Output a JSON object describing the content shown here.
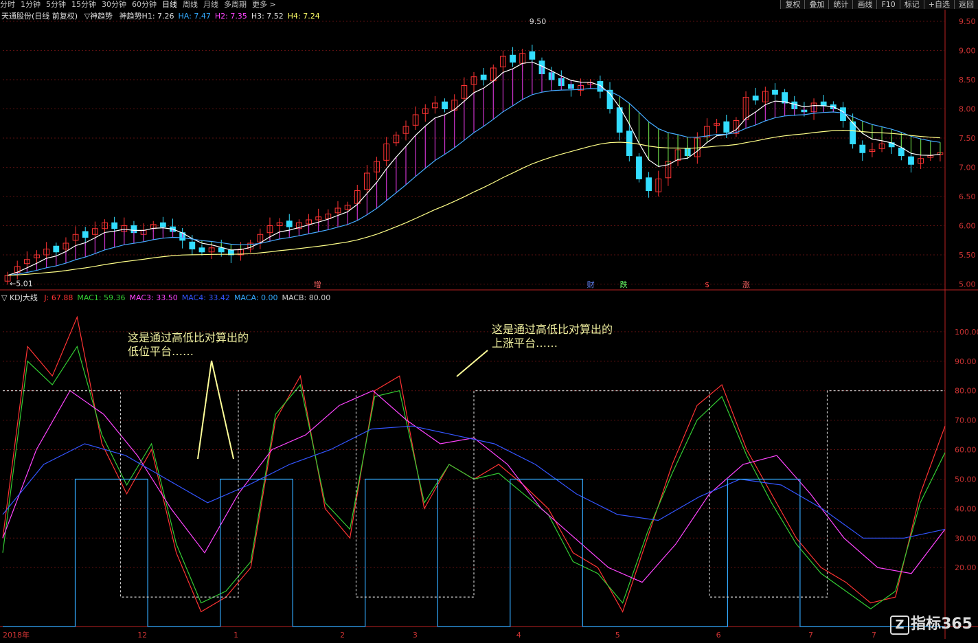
{
  "menu": {
    "periods": [
      "分时",
      "1分钟",
      "5分钟",
      "15分钟",
      "30分钟",
      "60分钟",
      "日线",
      "周线",
      "月线",
      "多周期",
      "更多 >"
    ],
    "active": "日线",
    "right_buttons": [
      "复权",
      "叠加",
      "统计",
      "画线",
      "F10",
      "标记",
      "+自选",
      "返回"
    ]
  },
  "main_info": {
    "title": "天通股份(日线 前复权)",
    "indicator": "▽神趋势",
    "items": [
      {
        "label": "神趋势H1: 7.26",
        "color": "#dddddd"
      },
      {
        "label": "HA: 7.47",
        "color": "#33aaff"
      },
      {
        "label": "H2: 7.35",
        "color": "#ff44ff"
      },
      {
        "label": "H3: 7.52",
        "color": "#dddddd"
      },
      {
        "label": "H4: 7.24",
        "color": "#ffff66"
      }
    ]
  },
  "sub_info": {
    "indicator": "▽ KDJ大线",
    "items": [
      {
        "label": "J: 67.88",
        "color": "#ff3333"
      },
      {
        "label": "MAC1: 59.36",
        "color": "#33cc33"
      },
      {
        "label": "MAC3: 33.50",
        "color": "#ff44ff"
      },
      {
        "label": "MAC4: 33.42",
        "color": "#3355ff"
      },
      {
        "label": "MACA: 0.00",
        "color": "#33aaff"
      },
      {
        "label": "MACB: 80.00",
        "color": "#cccccc"
      }
    ]
  },
  "price_axis": [
    "9.50",
    "9.00",
    "8.50",
    "8.00",
    "7.50",
    "7.00",
    "6.50",
    "6.00",
    "5.50",
    "5.00"
  ],
  "kdj_axis": [
    "100.00",
    "90.00",
    "80.00",
    "70.00",
    "60.00",
    "50.00",
    "40.00",
    "30.00",
    "20.00"
  ],
  "x_labels": [
    "2018年",
    "12",
    "1",
    "2",
    "3",
    "4",
    "5",
    "6",
    "7",
    "7"
  ],
  "marks": {
    "high": "9.50",
    "low": "5.01"
  },
  "events": [
    {
      "text": "增",
      "color": "#ff6666"
    },
    {
      "text": "财",
      "color": "#6688ff"
    },
    {
      "text": "跌",
      "color": "#66ff66"
    },
    {
      "text": "$",
      "color": "#ff4444"
    },
    {
      "text": "涨",
      "color": "#ff6666"
    }
  ],
  "annotations": [
    {
      "line1": "这是通过高低比对算出的",
      "line2": "低位平台……"
    },
    {
      "line1": "这是通过高低比对算出的",
      "line2": "上涨平台……"
    }
  ],
  "watermark": "指标365",
  "chart_data": [
    {
      "type": "candlestick",
      "ylim": [
        4.9,
        9.7
      ],
      "close": [
        5.15,
        5.3,
        5.42,
        5.5,
        5.6,
        5.55,
        5.7,
        5.85,
        5.8,
        5.95,
        6.05,
        5.95,
        6.0,
        5.88,
        5.92,
        6.02,
        5.98,
        5.9,
        5.75,
        5.6,
        5.55,
        5.62,
        5.55,
        5.5,
        5.6,
        5.7,
        5.85,
        6.0,
        6.05,
        5.98,
        6.05,
        6.1,
        6.15,
        6.2,
        6.3,
        6.35,
        6.6,
        6.9,
        7.1,
        7.4,
        7.55,
        7.7,
        7.9,
        8.0,
        8.1,
        8.0,
        8.15,
        8.4,
        8.55,
        8.5,
        8.7,
        8.9,
        8.8,
        8.95,
        8.85,
        8.6,
        8.5,
        8.4,
        8.35,
        8.4,
        8.45,
        8.3,
        8.0,
        7.6,
        7.2,
        6.8,
        6.6,
        6.8,
        7.1,
        7.3,
        7.2,
        7.5,
        7.7,
        7.75,
        7.6,
        7.8,
        8.2,
        8.15,
        8.3,
        8.25,
        8.1,
        8.0,
        7.95,
        8.1,
        8.05,
        8.0,
        7.8,
        7.4,
        7.25,
        7.3,
        7.4,
        7.35,
        7.2,
        7.05,
        7.15,
        7.2,
        7.25
      ],
      "open": [
        5.05,
        5.2,
        5.35,
        5.45,
        5.5,
        5.65,
        5.6,
        5.75,
        5.9,
        5.85,
        5.95,
        6.05,
        5.9,
        6.0,
        5.85,
        5.95,
        6.05,
        5.98,
        5.88,
        5.72,
        5.62,
        5.55,
        5.62,
        5.58,
        5.5,
        5.6,
        5.72,
        5.88,
        6.0,
        6.08,
        5.95,
        6.03,
        6.1,
        6.12,
        6.22,
        6.28,
        6.38,
        6.62,
        6.92,
        7.12,
        7.42,
        7.58,
        7.72,
        7.92,
        8.02,
        8.12,
        7.98,
        8.18,
        8.42,
        8.58,
        8.48,
        8.72,
        8.92,
        8.78,
        8.98,
        8.82,
        8.62,
        8.52,
        8.42,
        8.32,
        8.42,
        8.47,
        8.32,
        8.02,
        7.62,
        7.18,
        6.82,
        6.58,
        6.82,
        7.12,
        7.32,
        7.18,
        7.52,
        7.72,
        7.78,
        7.58,
        7.82,
        8.22,
        8.12,
        8.32,
        8.28,
        8.12,
        7.98,
        7.95,
        8.12,
        8.07,
        8.02,
        7.78,
        7.38,
        7.27,
        7.32,
        7.42,
        7.33,
        7.18,
        7.07,
        7.17,
        7.22
      ]
    },
    {
      "type": "line",
      "x_labels": [
        "2018年",
        "12",
        "1",
        "2",
        "3",
        "4",
        "5",
        "6",
        "7",
        "7"
      ],
      "ylim": [
        0,
        110
      ],
      "series": [
        {
          "name": "J",
          "color": "#ff3333",
          "values": [
            30,
            95,
            85,
            105,
            62,
            45,
            60,
            25,
            5,
            10,
            20,
            70,
            85,
            40,
            30,
            80,
            85,
            40,
            55,
            50,
            55,
            48,
            40,
            25,
            20,
            5,
            30,
            55,
            75,
            82,
            60,
            45,
            30,
            20,
            15,
            8,
            10,
            45,
            68
          ]
        },
        {
          "name": "MAC1",
          "color": "#33cc33",
          "values": [
            25,
            90,
            82,
            95,
            65,
            48,
            62,
            28,
            8,
            12,
            22,
            72,
            82,
            42,
            33,
            78,
            80,
            42,
            55,
            50,
            52,
            45,
            38,
            22,
            18,
            8,
            32,
            52,
            70,
            78,
            58,
            42,
            28,
            18,
            12,
            6,
            12,
            42,
            59
          ]
        },
        {
          "name": "MAC3",
          "color": "#ff44ff",
          "values": [
            30,
            60,
            80,
            72,
            58,
            40,
            25,
            45,
            60,
            65,
            75,
            80,
            70,
            62,
            64,
            55,
            40,
            30,
            20,
            15,
            28,
            45,
            55,
            58,
            45,
            30,
            20,
            18,
            33
          ]
        },
        {
          "name": "MAC4",
          "color": "#3355ff",
          "values": [
            38,
            55,
            62,
            58,
            50,
            42,
            48,
            55,
            60,
            67,
            68,
            65,
            62,
            55,
            45,
            38,
            36,
            44,
            50,
            48,
            40,
            30,
            30,
            33
          ]
        },
        {
          "name": "MACA",
          "color": "#33aaff",
          "values": [
            0,
            50,
            0,
            50,
            0,
            50,
            0,
            50,
            0,
            0,
            50,
            0,
            0
          ]
        },
        {
          "name": "MACB",
          "color": "#cccccc",
          "values": [
            80,
            10,
            80,
            10,
            80,
            80,
            10,
            80
          ]
        }
      ]
    }
  ]
}
